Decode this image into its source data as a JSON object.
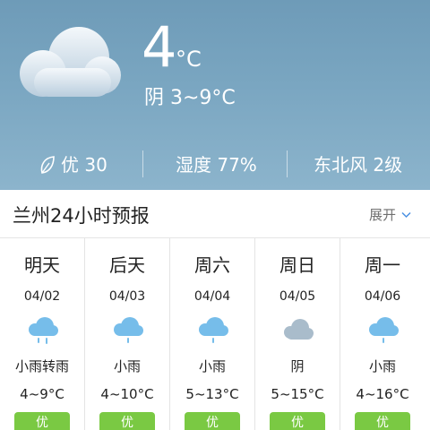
{
  "current": {
    "icon": "cloudy-icon",
    "temperature": "4",
    "unit": "°C",
    "condition_range": "阴 3~9°C"
  },
  "metrics": {
    "aqi": "优 30",
    "aqi_icon": "leaf-icon",
    "humidity": "湿度 77%",
    "wind": "东北风 2级"
  },
  "forecast": {
    "title": "兰州24小时预报",
    "expand_label": "展开",
    "days": [
      {
        "name": "明天",
        "date": "04/02",
        "icon": "rain-icon",
        "condition": "小雨转雨",
        "range": "4~9°C",
        "aqi": "优"
      },
      {
        "name": "后天",
        "date": "04/03",
        "icon": "rain-icon",
        "condition": "小雨",
        "range": "4~10°C",
        "aqi": "优"
      },
      {
        "name": "周六",
        "date": "04/04",
        "icon": "rain-icon",
        "condition": "小雨",
        "range": "5~13°C",
        "aqi": "优"
      },
      {
        "name": "周日",
        "date": "04/05",
        "icon": "cloudy-icon",
        "condition": "阴",
        "range": "5~15°C",
        "aqi": "优"
      },
      {
        "name": "周一",
        "date": "04/06",
        "icon": "rain-icon",
        "condition": "小雨",
        "range": "4~16°C",
        "aqi": "优"
      }
    ]
  },
  "colors": {
    "hero_bg": "#7aa6c1",
    "aqi_good": "#7ac943",
    "rain_cloud": "#76bdea",
    "overcast_cloud": "#a9bccb"
  }
}
